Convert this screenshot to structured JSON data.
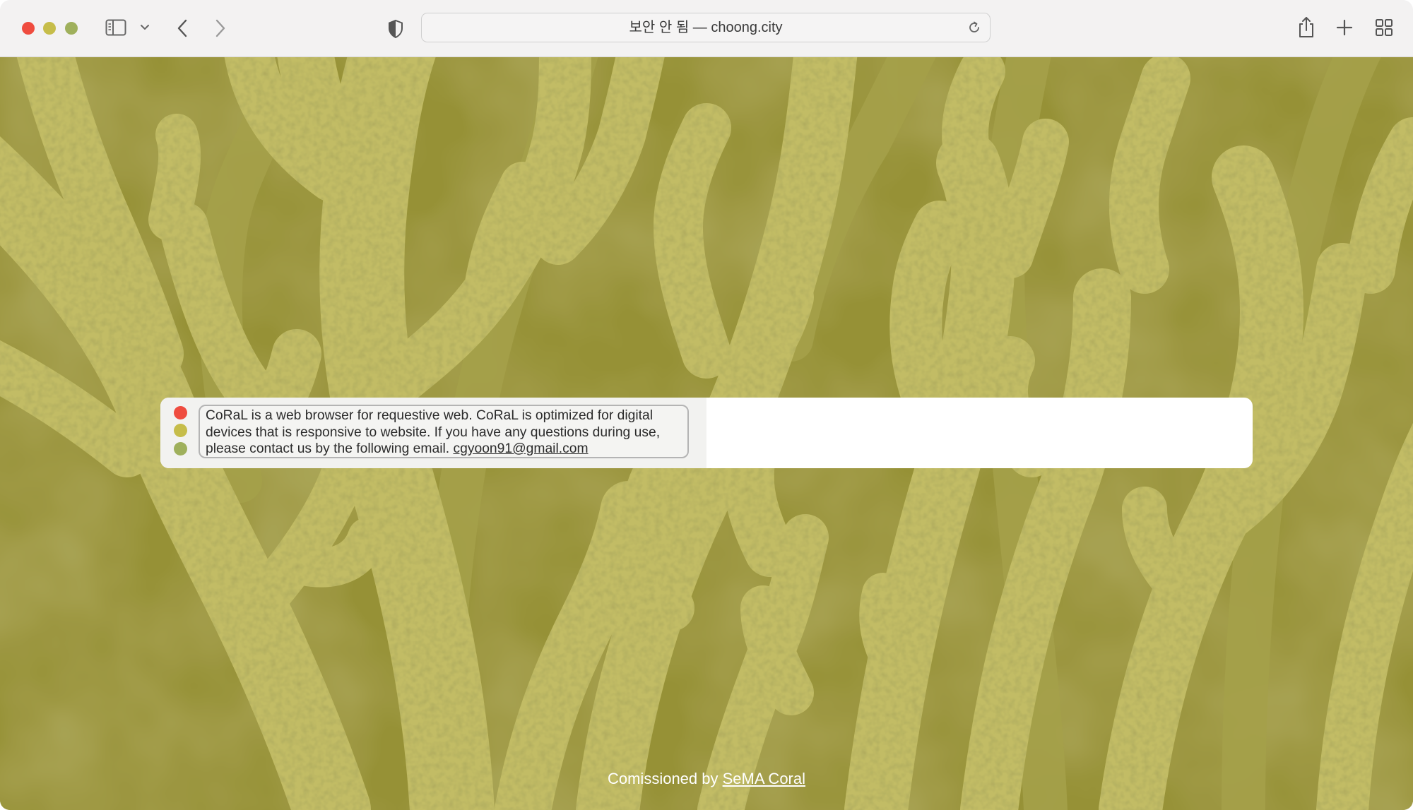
{
  "browser": {
    "address": "보안 안 됨 — choong.city",
    "icons": {
      "sidebar": "sidebar-icon",
      "sidebar_menu": "chevron-down-icon",
      "back": "chevron-left-icon",
      "forward": "chevron-right-icon",
      "privacy": "shield-icon",
      "reload": "reload-icon",
      "share": "share-icon",
      "new_tab": "plus-icon",
      "tab_overview": "grid-icon"
    },
    "traffic_lights": {
      "close": "#ef4c3f",
      "minimize": "#c6bd4a",
      "zoom": "#9fb05c"
    }
  },
  "page": {
    "message": {
      "text": "CoRaL is a web browser for requestive web. CoRaL is optimized for digital devices that is responsive to website. If you have any questions during use, please contact us by the following email. ",
      "email": "cgyoon91@gmail.com"
    },
    "dots": {
      "red": "#ef4c3f",
      "yellow": "#c6bd4a",
      "green": "#9fb05c"
    },
    "footer": {
      "prefix": "Comissioned by ",
      "link": "SeMA Coral"
    },
    "background": {
      "description_icon": "coral-photo",
      "tint": "#b9b35a"
    }
  }
}
